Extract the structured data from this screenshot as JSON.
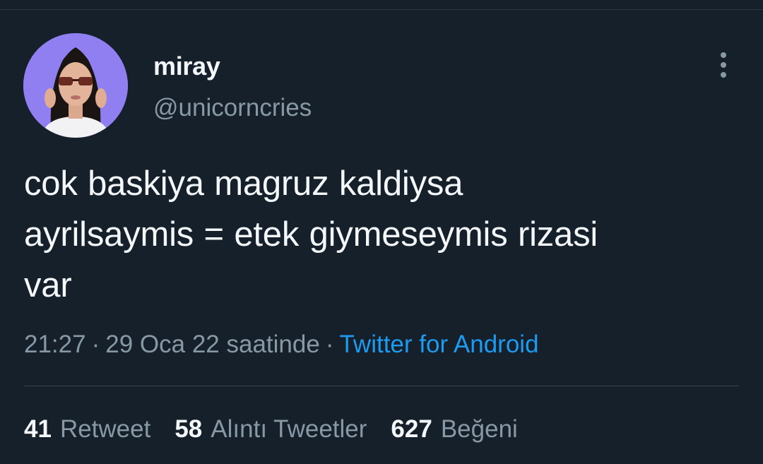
{
  "author": {
    "display_name": "miray",
    "handle": "@unicorncries"
  },
  "tweet": {
    "text_lines": [
      "cok baskiya magruz kaldiysa",
      "ayrilsaymis = etek giymeseymis rizasi",
      "var"
    ]
  },
  "meta": {
    "time": "21:27",
    "date_text": "29 Oca 22 saatinde",
    "separator": "·",
    "source": "Twitter for Android"
  },
  "stats": {
    "retweets": {
      "count": "41",
      "label": "Retweet"
    },
    "quotes": {
      "count": "58",
      "label": "Alıntı Tweetler"
    },
    "likes": {
      "count": "627",
      "label": "Beğeni"
    }
  },
  "icons": {
    "more": "more-vertical-icon"
  },
  "colors": {
    "background": "#15202b",
    "primary_text": "#f5f8fa",
    "secondary_text": "#8899a6",
    "link": "#1d9bf0",
    "avatar_bg": "#8f7ff0"
  }
}
